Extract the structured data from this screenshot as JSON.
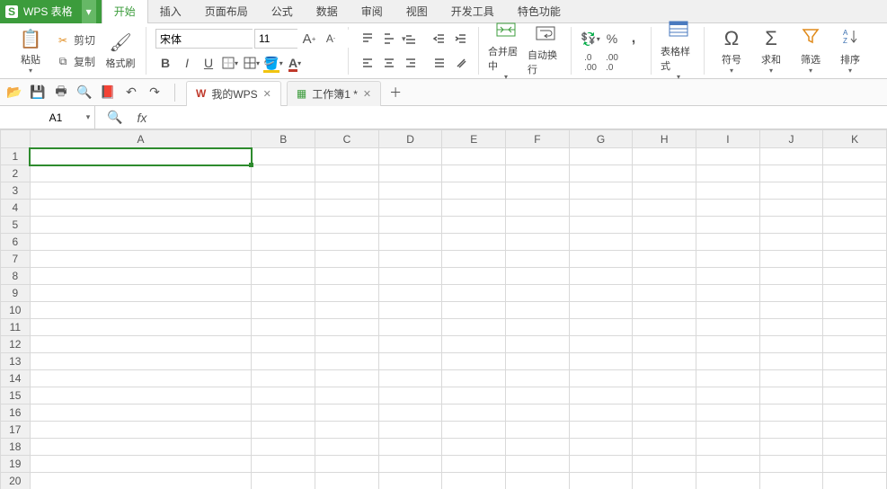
{
  "app": {
    "name": "WPS 表格"
  },
  "ribbon_tabs": [
    "开始",
    "插入",
    "页面布局",
    "公式",
    "数据",
    "审阅",
    "视图",
    "开发工具",
    "特色功能"
  ],
  "active_ribbon_tab": 0,
  "clipboard": {
    "paste": "粘贴",
    "cut": "剪切",
    "copy": "复制",
    "format_painter": "格式刷"
  },
  "font": {
    "family": "宋体",
    "size": "11",
    "bold": "B",
    "italic": "I",
    "underline": "U"
  },
  "merge": {
    "merge_center": "合并居中",
    "auto_wrap": "自动换行"
  },
  "number": {
    "inc_dec": "增加小数位数",
    "percent": "%",
    "comma": ","
  },
  "table_style": "表格样式",
  "symbols": {
    "symbol": "符号",
    "sum": "求和",
    "filter": "筛选",
    "sort": "排序"
  },
  "doc_tabs": [
    {
      "title": "我的WPS"
    },
    {
      "title": "工作簿1 *"
    }
  ],
  "name_box": "A1",
  "columns": [
    "A",
    "B",
    "C",
    "D",
    "E",
    "F",
    "G",
    "H",
    "I",
    "J",
    "K"
  ],
  "rows_visible": 20,
  "sel_row": 1,
  "sel_col": 0
}
